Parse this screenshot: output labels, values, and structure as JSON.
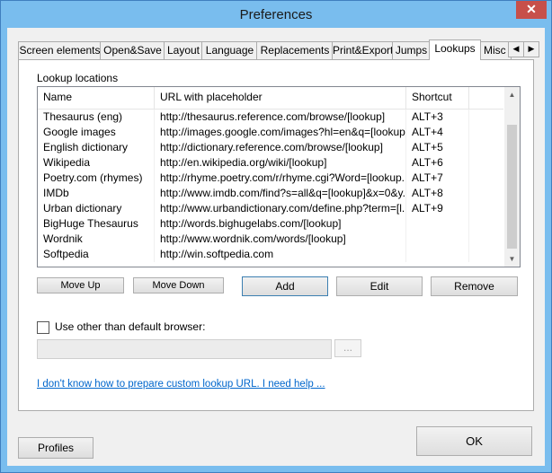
{
  "window": {
    "title": "Preferences",
    "close_glyph": "✕"
  },
  "tabs": [
    {
      "label": "Screen elements",
      "active": false
    },
    {
      "label": "Open&Save",
      "active": false
    },
    {
      "label": "Layout",
      "active": false
    },
    {
      "label": "Language",
      "active": false
    },
    {
      "label": "Replacements",
      "active": false
    },
    {
      "label": "Print&Export",
      "active": false
    },
    {
      "label": "Jumps",
      "active": false
    },
    {
      "label": "Lookups",
      "active": true
    },
    {
      "label": "Misc",
      "active": false
    }
  ],
  "tab_scroll": {
    "left": "◀",
    "right": "▶"
  },
  "lookups": {
    "section_label": "Lookup locations",
    "columns": [
      "Name",
      "URL with placeholder",
      "Shortcut"
    ],
    "rows": [
      {
        "name": "Thesaurus (eng)",
        "url": "http://thesaurus.reference.com/browse/[lookup]",
        "shortcut": "ALT+3"
      },
      {
        "name": "Google images",
        "url": "http://images.google.com/images?hl=en&q=[lookup]...",
        "shortcut": "ALT+4"
      },
      {
        "name": "English dictionary",
        "url": "http://dictionary.reference.com/browse/[lookup]",
        "shortcut": "ALT+5"
      },
      {
        "name": "Wikipedia",
        "url": "http://en.wikipedia.org/wiki/[lookup]",
        "shortcut": "ALT+6"
      },
      {
        "name": "Poetry.com (rhymes)",
        "url": "http://rhyme.poetry.com/r/rhyme.cgi?Word=[lookup...",
        "shortcut": "ALT+7"
      },
      {
        "name": "IMDb",
        "url": "http://www.imdb.com/find?s=all&q=[lookup]&x=0&y...",
        "shortcut": "ALT+8"
      },
      {
        "name": "Urban dictionary",
        "url": "http://www.urbandictionary.com/define.php?term=[l...",
        "shortcut": "ALT+9"
      },
      {
        "name": "BigHuge Thesaurus",
        "url": "http://words.bighugelabs.com/[lookup]",
        "shortcut": ""
      },
      {
        "name": "Wordnik",
        "url": "http://www.wordnik.com/words/[lookup]",
        "shortcut": ""
      },
      {
        "name": "Softpedia",
        "url": "http://win.softpedia.com",
        "shortcut": ""
      }
    ],
    "buttons": {
      "move_up": "Move Up",
      "move_down": "Move Down",
      "add": "Add",
      "edit": "Edit",
      "remove": "Remove"
    },
    "browser": {
      "checkbox_label": "Use other than default browser:",
      "checked": false,
      "path_value": "",
      "browse_label": "..."
    },
    "help_link": "I don't know how to prepare custom lookup URL. I need help ..."
  },
  "footer": {
    "profiles": "Profiles",
    "ok": "OK"
  }
}
